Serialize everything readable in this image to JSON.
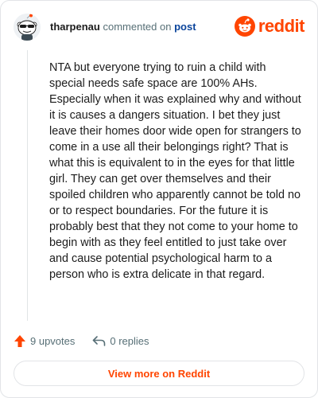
{
  "header": {
    "username": "tharpenau",
    "action_text": "commented on",
    "post_link": "post",
    "brand": "reddit"
  },
  "comment": {
    "body": "NTA but everyone trying to ruin a child with special needs safe space are 100% AHs. Especially when it was explained why and without it is causes a dangers situation. I bet they just leave their homes door wide open for strangers to come in a use all their belongings right? That is what this is equivalent to in the eyes for that little girl. They can get over themselves and their spoiled children who apparently cannot be told no or to respect boundaries. For the future it is probably best that they not come to your home to begin with as they feel entitled to just take over and cause potential psychological harm to a person who is extra delicate in that regard."
  },
  "actions": {
    "upvotes": "9 upvotes",
    "replies": "0 replies"
  },
  "footer": {
    "view_more": "View more on Reddit"
  },
  "colors": {
    "brand": "#ff4500",
    "link": "#0a449b",
    "muted": "#576f76",
    "text": "#1c1c1c"
  },
  "icons": {
    "avatar": "snoo-avatar-with-sunglasses",
    "brand": "reddit-logo-icon",
    "upvote": "upvote-arrow-icon",
    "reply": "reply-arrow-icon"
  }
}
